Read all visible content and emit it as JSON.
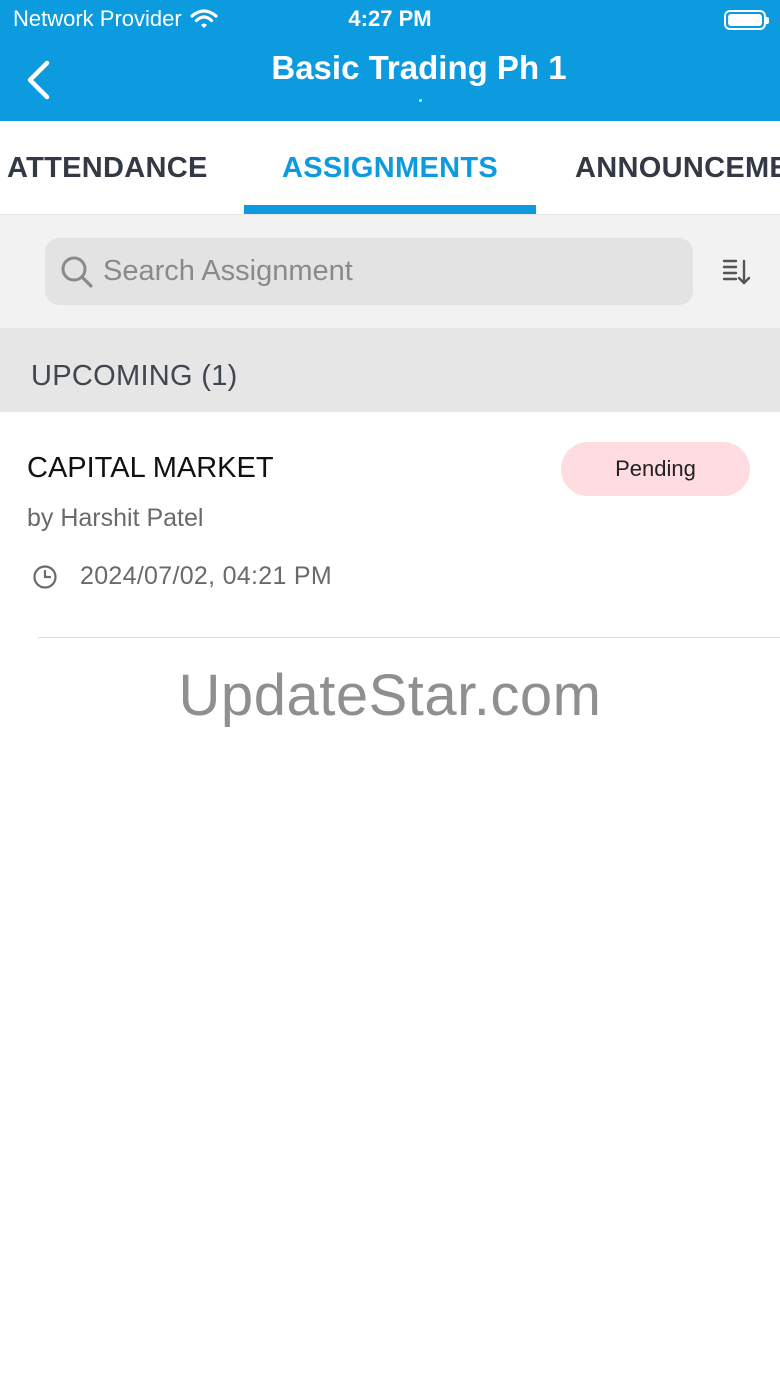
{
  "status_bar": {
    "carrier": "Network Provider",
    "time": "4:27 PM"
  },
  "header": {
    "title": "Basic Trading Ph 1",
    "accent_color": "#0d9be0"
  },
  "tabs": [
    {
      "label": "ATTENDANCE",
      "active": false
    },
    {
      "label": "ASSIGNMENTS",
      "active": true
    },
    {
      "label": "ANNOUNCEME",
      "active": false
    }
  ],
  "search": {
    "placeholder": "Search Assignment",
    "value": ""
  },
  "section": {
    "title": "UPCOMING (1)"
  },
  "assignments": [
    {
      "title": "CAPITAL MARKET",
      "author": "by Harshit Patel",
      "datetime": "2024/07/02, 04:21 PM",
      "status": "Pending",
      "status_color": "#ffdce2"
    }
  ],
  "watermark": "UpdateStar.com",
  "icons": {
    "back": "chevron-left-icon",
    "search": "search-icon",
    "sort": "sort-icon",
    "clock": "clock-icon",
    "wifi": "wifi-icon",
    "battery": "battery-icon"
  }
}
